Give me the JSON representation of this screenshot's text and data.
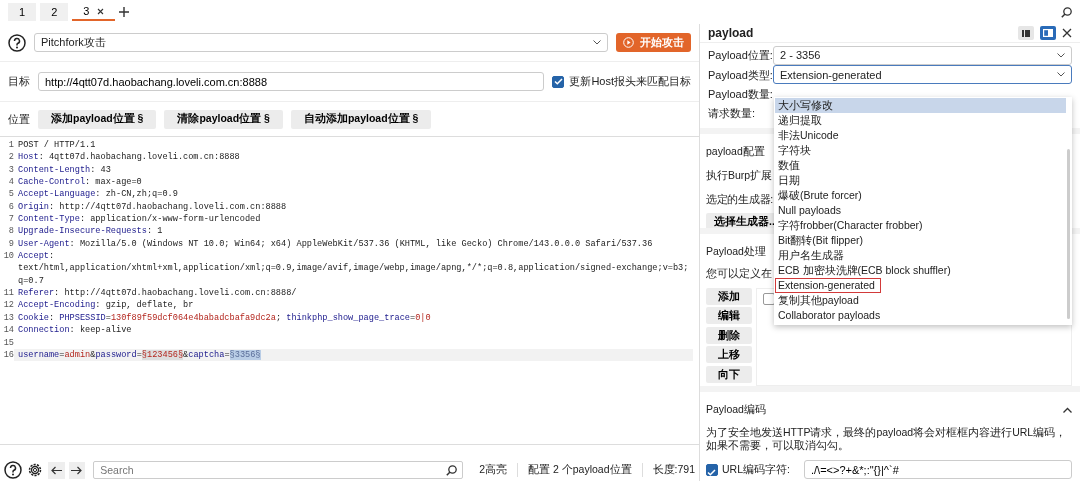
{
  "tabs": [
    {
      "label": "1",
      "selected": false,
      "closable": false
    },
    {
      "label": "2",
      "selected": false,
      "closable": false
    },
    {
      "label": "3",
      "selected": true,
      "closable": true
    }
  ],
  "attack": {
    "type": "Pitchfork攻击",
    "start_button": "开始攻击"
  },
  "target": {
    "label": "目标",
    "url": "http://4qtt07d.haobachang.loveli.com.cn:8888",
    "update_host": {
      "label": "更新Host报头来匹配目标",
      "checked": true
    }
  },
  "positions": {
    "label": "位置",
    "buttons": [
      "添加payload位置 §",
      "清除payload位置 §",
      "自动添加payload位置 §"
    ]
  },
  "editor": {
    "lines": [
      {
        "n": "1",
        "parts": [
          {
            "text": "POST / HTTP/1.1",
            "kind": "text"
          }
        ]
      },
      {
        "n": "2",
        "parts": [
          {
            "text": "Host",
            "kind": "name"
          },
          {
            "text": ": 4qtt07d.haobachang.loveli.com.cn:8888",
            "kind": "text"
          }
        ]
      },
      {
        "n": "3",
        "parts": [
          {
            "text": "Content-Length",
            "kind": "name"
          },
          {
            "text": ": 43",
            "kind": "text"
          }
        ]
      },
      {
        "n": "4",
        "parts": [
          {
            "text": "Cache-Control",
            "kind": "name"
          },
          {
            "text": ": max-age=0",
            "kind": "text"
          }
        ]
      },
      {
        "n": "5",
        "parts": [
          {
            "text": "Accept-Language",
            "kind": "name"
          },
          {
            "text": ": zh-CN,zh;q=0.9",
            "kind": "text"
          }
        ]
      },
      {
        "n": "6",
        "parts": [
          {
            "text": "Origin",
            "kind": "name"
          },
          {
            "text": ": http://4qtt07d.haobachang.loveli.com.cn:8888",
            "kind": "text"
          }
        ]
      },
      {
        "n": "7",
        "parts": [
          {
            "text": "Content-Type",
            "kind": "name"
          },
          {
            "text": ": application/x-www-form-urlencoded",
            "kind": "text"
          }
        ]
      },
      {
        "n": "8",
        "parts": [
          {
            "text": "Upgrade-Insecure-Requests",
            "kind": "name"
          },
          {
            "text": ": 1",
            "kind": "text"
          }
        ]
      },
      {
        "n": "9",
        "parts": [
          {
            "text": "User-Agent",
            "kind": "name"
          },
          {
            "text": ": Mozilla/5.0 (Windows NT 10.0; Win64; x64) AppleWebKit/537.36 (KHTML, like Gecko) Chrome/143.0.0.0 Safari/537.36",
            "kind": "text"
          }
        ]
      },
      {
        "n": "10",
        "parts": [
          {
            "text": "Accept",
            "kind": "name"
          },
          {
            "text": ":",
            "kind": "text"
          }
        ]
      },
      {
        "parts": [
          {
            "text": "text/html,application/xhtml+xml,application/xml;q=0.9,image/avif,image/webp,image/apng,*/*;q=0.8,application/signed-exchange;v=b3;",
            "kind": "text"
          }
        ]
      },
      {
        "parts": [
          {
            "text": "q=0.7",
            "kind": "text"
          }
        ]
      },
      {
        "n": "11",
        "parts": [
          {
            "text": "Referer",
            "kind": "name"
          },
          {
            "text": ": http://4qtt07d.haobachang.loveli.com.cn:8888/",
            "kind": "text"
          }
        ]
      },
      {
        "n": "12",
        "parts": [
          {
            "text": "Accept-Encoding",
            "kind": "name"
          },
          {
            "text": ": gzip, deflate, br",
            "kind": "text"
          }
        ]
      },
      {
        "n": "13",
        "parts": [
          {
            "text": "Cookie",
            "kind": "name"
          },
          {
            "text": ": ",
            "kind": "text"
          },
          {
            "text": "PHPSESSID",
            "kind": "name"
          },
          {
            "text": "=",
            "kind": "text"
          },
          {
            "text": "130f89f59dcf064e4babadcbafa9dc2a",
            "kind": "value"
          },
          {
            "text": "; ",
            "kind": "text"
          },
          {
            "text": "thinkphp_show_page_trace",
            "kind": "name"
          },
          {
            "text": "=",
            "kind": "text"
          },
          {
            "text": "0|0",
            "kind": "value"
          }
        ]
      },
      {
        "n": "14",
        "parts": [
          {
            "text": "Connection",
            "kind": "name"
          },
          {
            "text": ": keep-alive",
            "kind": "text"
          }
        ]
      },
      {
        "n": "15"
      },
      {
        "n": "16",
        "current": true,
        "parts": [
          {
            "text": "username",
            "kind": "name"
          },
          {
            "text": "=",
            "kind": "text"
          },
          {
            "text": "admin",
            "kind": "value"
          },
          {
            "text": "&",
            "kind": "text"
          },
          {
            "text": "password",
            "kind": "name"
          },
          {
            "text": "=",
            "kind": "text"
          },
          {
            "text": "§123456§",
            "kind": "marker"
          },
          {
            "text": "&",
            "kind": "text"
          },
          {
            "text": "captcha",
            "kind": "name"
          },
          {
            "text": "=",
            "kind": "text"
          },
          {
            "text": "§3356§",
            "kind": "active_marker"
          }
        ]
      }
    ]
  },
  "status_bar": {
    "search_placeholder": "Search",
    "highlights": "2高亮",
    "positions": "配置 2 个payload位置",
    "length": "长度:791"
  },
  "payload_panel": {
    "title": "payload",
    "layout_modes": [
      {
        "selected": false
      },
      {
        "selected": true
      }
    ],
    "fields": [
      {
        "label": "Payload位置:",
        "kind": "select",
        "value": "2 - 3356",
        "focused": false
      },
      {
        "label": "Payload类型:",
        "kind": "select",
        "value": "Extension-generated",
        "focused": true
      },
      {
        "label": "Payload数量:",
        "kind": "text"
      },
      {
        "label": "请求数量:",
        "kind": "text"
      }
    ],
    "type_menu": [
      {
        "label": "大小写修改",
        "hovered": true,
        "selected": false
      },
      {
        "label": "递归提取",
        "hovered": false,
        "selected": false
      },
      {
        "label": "非法Unicode",
        "hovered": false,
        "selected": false
      },
      {
        "label": "字符块",
        "hovered": false,
        "selected": false
      },
      {
        "label": "数值",
        "hovered": false,
        "selected": false
      },
      {
        "label": "日期",
        "hovered": false,
        "selected": false
      },
      {
        "label": "爆破(Brute forcer)",
        "hovered": false,
        "selected": false
      },
      {
        "label": "Null payloads",
        "hovered": false,
        "selected": false
      },
      {
        "label": "字符frobber(Character frobber)",
        "hovered": false,
        "selected": false
      },
      {
        "label": "Bit翻转(Bit flipper)",
        "hovered": false,
        "selected": false
      },
      {
        "label": "用户名生成器",
        "hovered": false,
        "selected": false
      },
      {
        "label": "ECB 加密块洗牌(ECB block shuffler)",
        "hovered": false,
        "selected": false
      },
      {
        "label": "Extension-generated",
        "hovered": false,
        "selected": true
      },
      {
        "label": "复制其他payload",
        "hovered": false,
        "selected": false
      },
      {
        "label": "Collaborator payloads",
        "hovered": false,
        "selected": false
      }
    ],
    "config": {
      "title": "payload配置",
      "description": "执行Burp扩展",
      "generator": "选定的生成器:",
      "button": "选择生成器.."
    },
    "processing": {
      "title": "Payload处理",
      "description": "您可以定义在",
      "buttons": [
        "添加",
        "编辑",
        "删除",
        "上移",
        "向下"
      ],
      "rule_checked": false
    },
    "encoding": {
      "title": "Payload编码",
      "expanded": true,
      "description": "为了安全地发送HTTP请求，最终的payload将会对框框内容进行URL编码，如果不需要，可以取消勾勾。",
      "url_encode": {
        "label": "URL编码字符:",
        "checked": true,
        "value": "./\\=<>?+&*;:\"{}|^`#"
      }
    }
  }
}
